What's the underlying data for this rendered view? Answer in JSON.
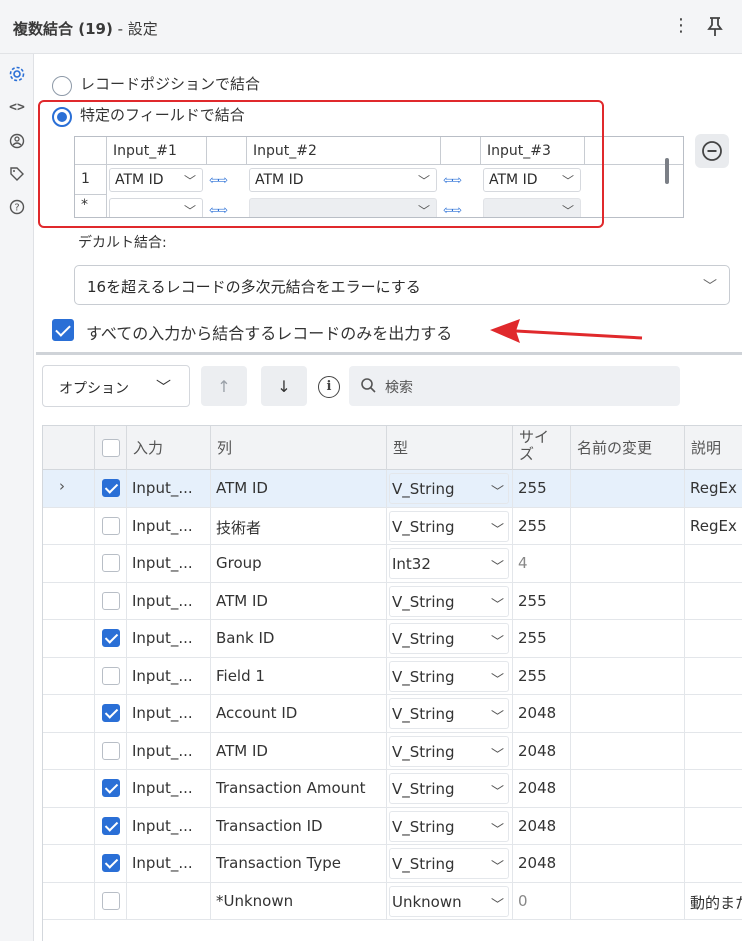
{
  "header": {
    "title_bold": "複数結合 (19)",
    "title_rest": " - 設定",
    "menu_icon": "kebab-menu-icon",
    "pin_icon": "pin-icon"
  },
  "rail": {
    "items": [
      {
        "icon": "gear-icon",
        "glyph": "⚙"
      },
      {
        "icon": "code-icon",
        "glyph": "<>"
      },
      {
        "icon": "connection-icon",
        "glyph": "⊛"
      },
      {
        "icon": "tag-icon",
        "glyph": "◇"
      },
      {
        "icon": "help-icon",
        "glyph": "?"
      }
    ]
  },
  "join": {
    "option_position": "レコードポジションで結合",
    "option_field": "特定のフィールドで結合",
    "grid": {
      "headers": [
        "Input_#1",
        "Input_#2",
        "Input_#3"
      ],
      "row1_index": "1",
      "row1_values": [
        "ATM ID",
        "ATM ID",
        "ATM ID"
      ],
      "new_row_marker": "*"
    },
    "arrow_glyph": "⇦⇨"
  },
  "default_join": {
    "label": "デカルト結合:",
    "value": "16を超えるレコードの多次元結合をエラーにする"
  },
  "only_matched": {
    "label": "すべての入力から結合するレコードのみを出力する",
    "checked": true
  },
  "toolbar": {
    "options_label": "オプション",
    "up_glyph": "↑",
    "down_glyph": "↓",
    "info_glyph": "i",
    "search_placeholder": "検索"
  },
  "fields": {
    "headers": {
      "input": "入力",
      "column": "列",
      "type": "型",
      "size": "サイズ",
      "rename": "名前の変更",
      "description": "説明"
    },
    "rows": [
      {
        "checked": true,
        "input": "Input_...",
        "column": "ATM ID",
        "type": "V_String",
        "size": "255",
        "desc": "RegEx",
        "selected": true
      },
      {
        "checked": false,
        "input": "Input_...",
        "column": "技術者",
        "type": "V_String",
        "size": "255",
        "desc": "RegEx"
      },
      {
        "checked": false,
        "input": "Input_...",
        "column": "Group",
        "type": "Int32",
        "size": "4",
        "desc": "",
        "size_dim": true
      },
      {
        "checked": false,
        "input": "Input_...",
        "column": "ATM ID",
        "type": "V_String",
        "size": "255",
        "desc": ""
      },
      {
        "checked": true,
        "input": "Input_...",
        "column": "Bank ID",
        "type": "V_String",
        "size": "255",
        "desc": ""
      },
      {
        "checked": false,
        "input": "Input_...",
        "column": "Field 1",
        "type": "V_String",
        "size": "255",
        "desc": ""
      },
      {
        "checked": true,
        "input": "Input_...",
        "column": "Account ID",
        "type": "V_String",
        "size": "2048",
        "desc": ""
      },
      {
        "checked": false,
        "input": "Input_...",
        "column": "ATM ID",
        "type": "V_String",
        "size": "2048",
        "desc": ""
      },
      {
        "checked": true,
        "input": "Input_...",
        "column": "Transaction Amount",
        "type": "V_String",
        "size": "2048",
        "desc": ""
      },
      {
        "checked": true,
        "input": "Input_...",
        "column": "Transaction ID",
        "type": "V_String",
        "size": "2048",
        "desc": ""
      },
      {
        "checked": true,
        "input": "Input_...",
        "column": "Transaction Type",
        "type": "V_String",
        "size": "2048",
        "desc": ""
      },
      {
        "checked": false,
        "input": "",
        "column": "*Unknown",
        "type": "Unknown",
        "size": "0",
        "desc": "動的また",
        "size_dim": true
      }
    ]
  },
  "colors": {
    "accent": "#2a6fd6",
    "annotation_red": "#e0292c"
  }
}
